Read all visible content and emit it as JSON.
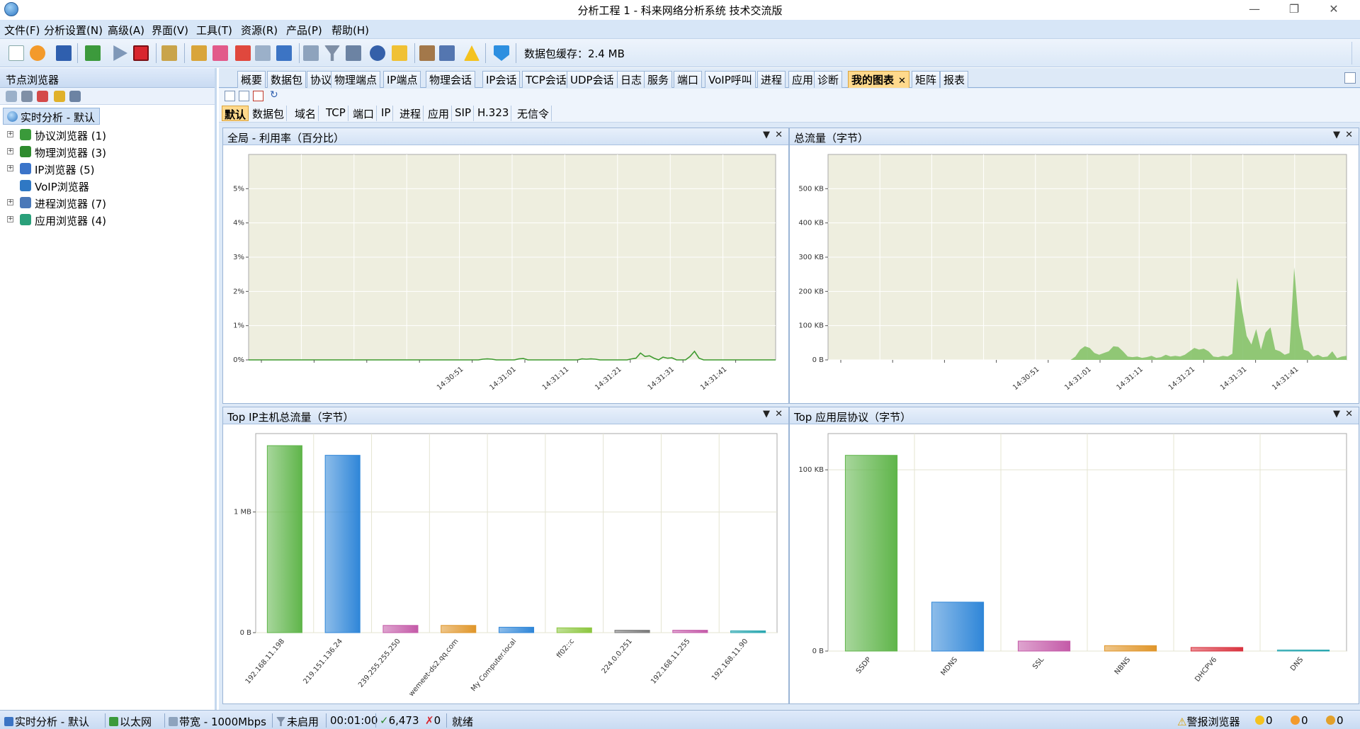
{
  "window": {
    "title": "分析工程 1 - 科来网络分析系统 技术交流版"
  },
  "menu": [
    "文件(F)",
    "分析设置(N)",
    "高级(A)",
    "界面(V)",
    "工具(T)",
    "资源(R)",
    "产品(P)",
    "帮助(H)"
  ],
  "toolbar": {
    "cache_label": "数据包缓存：2.4 MB"
  },
  "left_panel": {
    "title": "节点浏览器",
    "root": "实时分析 - 默认",
    "items": [
      {
        "label": "协议浏览器 (1)",
        "icon": "protocol-icon",
        "color": "#3a9a3a"
      },
      {
        "label": "物理浏览器 (3)",
        "icon": "physical-icon",
        "color": "#2e8b2e"
      },
      {
        "label": "IP浏览器 (5)",
        "icon": "ip-icon",
        "color": "#3b74c9"
      },
      {
        "label": "VoIP浏览器",
        "icon": "voip-icon",
        "color": "#2f78c4"
      },
      {
        "label": "进程浏览器 (7)",
        "icon": "process-icon",
        "color": "#4a78b8"
      },
      {
        "label": "应用浏览器 (4)",
        "icon": "app-icon",
        "color": "#2aa07a"
      }
    ]
  },
  "tabs": [
    {
      "label": "概要"
    },
    {
      "label": "数据包"
    },
    {
      "label": "协议"
    },
    {
      "label": "物理端点"
    },
    {
      "label": "IP端点"
    },
    {
      "label": "物理会话"
    },
    {
      "label": "IP会话"
    },
    {
      "label": "TCP会话"
    },
    {
      "label": "UDP会话"
    },
    {
      "label": "日志"
    },
    {
      "label": "服务"
    },
    {
      "label": "端口"
    },
    {
      "label": "VoIP呼叫"
    },
    {
      "label": "进程"
    },
    {
      "label": "应用"
    },
    {
      "label": "诊断"
    },
    {
      "label": "我的图表",
      "active": true
    },
    {
      "label": "矩阵"
    },
    {
      "label": "报表"
    }
  ],
  "subtabs": [
    "默认",
    "数据包",
    "域名",
    "TCP",
    "端口",
    "IP",
    "进程",
    "应用",
    "SIP",
    "H.323",
    "无信令"
  ],
  "panels": {
    "utilization": {
      "title": "全局 - 利用率（百分比）"
    },
    "traffic": {
      "title": "总流量（字节）"
    },
    "top_ip": {
      "title": "Top IP主机总流量（字节）"
    },
    "top_app": {
      "title": "Top 应用层协议（字节）"
    }
  },
  "chart_data": [
    {
      "type": "line",
      "id": "utilization",
      "ylim": [
        0,
        6
      ],
      "yticks": [
        "0%",
        "1%",
        "2%",
        "3%",
        "4%",
        "5%"
      ],
      "xticks": [
        "14:30:51",
        "14:31:01",
        "14:31:11",
        "14:31:21",
        "14:31:31",
        "14:31:41"
      ],
      "color": "#3d9a2e",
      "values": [
        0,
        0,
        0,
        0,
        0,
        0,
        0,
        0,
        0,
        0,
        0,
        0,
        0,
        0,
        0,
        0,
        0,
        0,
        0,
        0,
        0,
        0,
        0,
        0,
        0,
        0,
        0,
        0,
        0,
        0,
        0,
        0,
        0,
        0,
        0,
        0,
        0,
        0,
        0,
        0,
        0,
        0,
        0,
        0,
        0,
        0,
        0,
        0,
        0,
        0,
        0,
        0,
        0.02,
        0.03,
        0.02,
        0,
        0,
        0,
        0,
        0,
        0.03,
        0.04,
        0,
        0,
        0,
        0,
        0,
        0,
        0,
        0,
        0,
        0,
        0,
        0,
        0.03,
        0.02,
        0.03,
        0.02,
        0,
        0,
        0,
        0,
        0,
        0,
        0,
        0.03,
        0.05,
        0.2,
        0.1,
        0.12,
        0.05,
        0,
        0.08,
        0.05,
        0.06,
        0,
        0,
        0,
        0.1,
        0.25,
        0.05,
        0,
        0,
        0,
        0,
        0,
        0,
        0,
        0,
        0,
        0,
        0,
        0,
        0,
        0,
        0,
        0,
        0
      ]
    },
    {
      "type": "area",
      "id": "traffic",
      "ylim": [
        0,
        600
      ],
      "yunit": "KB",
      "yticks": [
        "0 B",
        "100 KB",
        "200 KB",
        "300 KB",
        "400 KB",
        "500 KB"
      ],
      "xticks": [
        "14:30:51",
        "14:31:01",
        "14:31:11",
        "14:31:21",
        "14:31:31",
        "14:31:41"
      ],
      "color": "#7fbf63",
      "values": [
        0,
        0,
        0,
        0,
        0,
        0,
        0,
        0,
        0,
        0,
        0,
        0,
        0,
        0,
        0,
        0,
        0,
        0,
        0,
        0,
        0,
        0,
        0,
        0,
        0,
        0,
        0,
        0,
        0,
        0,
        0,
        0,
        0,
        0,
        0,
        0,
        0,
        0,
        0,
        0,
        0,
        0,
        0,
        0,
        0,
        0,
        0,
        0,
        0,
        0,
        0,
        0,
        10,
        30,
        40,
        35,
        20,
        15,
        20,
        25,
        40,
        38,
        25,
        10,
        8,
        10,
        6,
        8,
        12,
        6,
        8,
        15,
        10,
        12,
        10,
        15,
        25,
        35,
        30,
        33,
        25,
        10,
        8,
        12,
        10,
        18,
        240,
        150,
        70,
        45,
        90,
        30,
        80,
        95,
        30,
        25,
        15,
        20,
        270,
        100,
        30,
        25,
        10,
        15,
        8,
        10,
        25,
        5,
        10,
        12
      ]
    },
    {
      "type": "bar",
      "id": "top_ip",
      "ylim": [
        0,
        1.65
      ],
      "yunit": "MB",
      "yticks": [
        {
          "v": 0,
          "label": "0 B"
        },
        {
          "v": 1,
          "label": "1 MB"
        }
      ],
      "categories": [
        "192.168.11.198",
        "219.151.136.24",
        "239.255.255.250",
        "wemeet-ds2.qq.com",
        "My Computer.local",
        "ff02::c",
        "224.0.0.251",
        "192.168.11.255",
        "192.168.11.90"
      ],
      "values": [
        1.55,
        1.47,
        0.06,
        0.06,
        0.045,
        0.04,
        0.02,
        0.02,
        0.015
      ],
      "colors": [
        "#5fb54a",
        "#2f86d8",
        "#c45aa8",
        "#e0962a",
        "#2f86d8",
        "#8cc63f",
        "#7a7a7a",
        "#c45aa8",
        "#2aa7b0"
      ]
    },
    {
      "type": "bar",
      "id": "top_app",
      "ylim": [
        0,
        120
      ],
      "yunit": "KB",
      "yticks": [
        {
          "v": 0,
          "label": "0 B"
        },
        {
          "v": 100,
          "label": "100 KB"
        }
      ],
      "categories": [
        "SSDP",
        "MDNS",
        "SSL",
        "NBNS",
        "DHCPV6",
        "DNS"
      ],
      "values": [
        108,
        27,
        5.5,
        3,
        2,
        0.5
      ],
      "colors": [
        "#5fb54a",
        "#2f86d8",
        "#c45aa8",
        "#e0962a",
        "#d9333f",
        "#2aa7b0"
      ]
    }
  ],
  "statusbar": {
    "mode": "实时分析 - 默认",
    "adapter": "以太网",
    "bandwidth": "带宽 - 1000Mbps",
    "filter": "未启用",
    "duration": "00:01:00",
    "ok_count": "6,473",
    "err_count": "0",
    "state": "就绪",
    "alarm": "警报浏览器",
    "alarm_counts": [
      "0",
      "0",
      "0"
    ]
  }
}
